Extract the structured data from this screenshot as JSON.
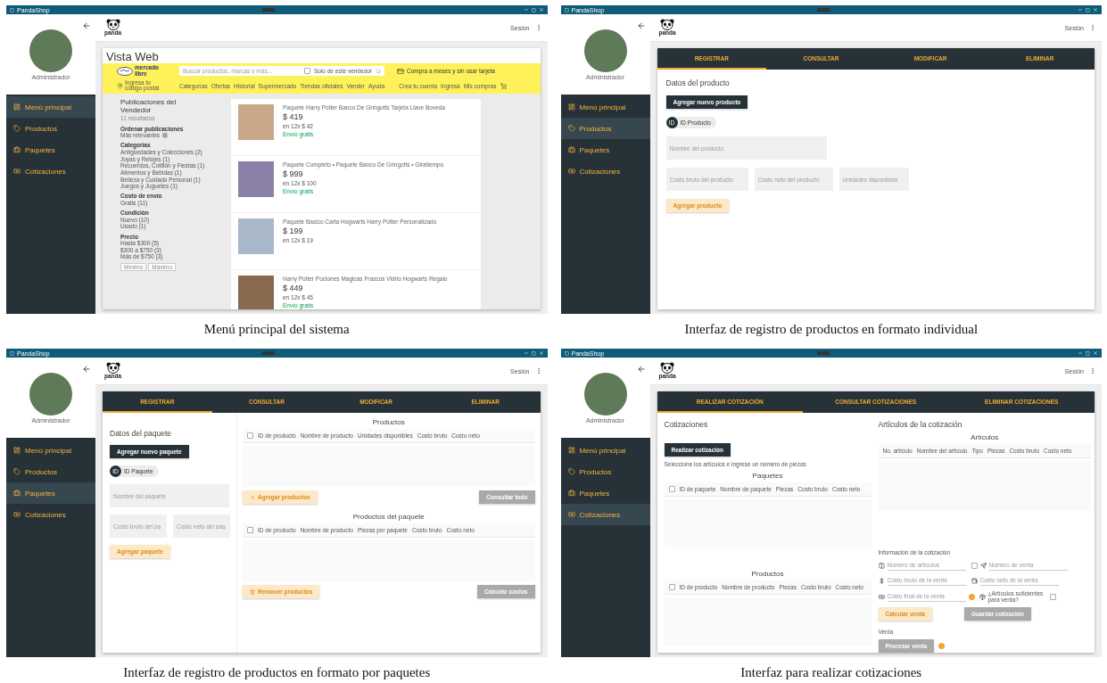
{
  "figures": [
    {
      "kind": "web",
      "caption": "Menú principal del sistema",
      "window_title": "PandaShop",
      "user": "Administrador",
      "session": "Sesión",
      "logo_text": "panda",
      "menu": [
        {
          "label": "Menú principal",
          "selected": true
        },
        {
          "label": "Productos",
          "selected": false
        },
        {
          "label": "Paquetes",
          "selected": false
        },
        {
          "label": "Cotizaciones",
          "selected": false
        }
      ],
      "content": {
        "title": "Vista Web",
        "store": {
          "logo_text": "mercado libre",
          "search_placeholder": "Buscar productos, marcas y más...",
          "seller_only": "Solo de este vendedor",
          "seller_only_checked": false,
          "promo": "Compra a meses y sin usar tarjeta",
          "location_top": "Ingresa tu",
          "location_bottom": "código postal",
          "nav": [
            "Categorías",
            "Ofertas",
            "Historial",
            "Supermercado",
            "Tiendas oficiales",
            "Vender",
            "Ayuda"
          ],
          "account": [
            "Crea tu cuenta",
            "Ingresa",
            "Mis compras"
          ]
        },
        "filters": {
          "title": "Publicaciones del Vendedor",
          "results": "11 resultados",
          "sort_title": "Ordenar publicaciones",
          "sort_value": "Más relevantes",
          "groups": [
            {
              "title": "Categorías",
              "items": [
                "Antigüedades y Colecciones (2)",
                "Joyas y Relojes (1)",
                "Recuerdos, Cotillón y Fiestas (1)",
                "Alimentos y Bebidas (1)",
                "Belleza y Cuidado Personal (1)",
                "Juegos y Juguetes (1)"
              ]
            },
            {
              "title": "Costo de envío",
              "items": [
                "Gratis (11)"
              ]
            },
            {
              "title": "Condición",
              "items": [
                "Nuevo (10)",
                "Usado (1)"
              ]
            },
            {
              "title": "Precio",
              "items": [
                "Hasta $300 (5)",
                "$300 a $750 (3)",
                "Más de $750 (3)"
              ]
            }
          ],
          "min": "Mínimo",
          "max": "Máximo"
        },
        "listings": [
          {
            "title": "Paquete Harry Potter Banco De Gringotts Tarjeta Llave Boveda",
            "price": "$ 419",
            "installments": "en 12x $ 42",
            "shipping": "Envío gratis"
          },
          {
            "title": "Paquete Completo • Paquete Banco De Gringotts • Giratiempo",
            "price": "$ 999",
            "installments": "en 12x $ 100",
            "shipping": "Envío gratis"
          },
          {
            "title": "Paquete Basico Carta Hogwarts Harry Potter Personalizado",
            "price": "$ 199",
            "installments": "en 12x $ 19"
          },
          {
            "title": "Harry Potter Pociones Magicas Frascos Vidrio Hogwarts Regalo",
            "price": "$ 449",
            "installments": "en 12x $ 45",
            "shipping": "Envío gratis"
          }
        ]
      }
    },
    {
      "kind": "product",
      "caption": "Interfaz de registro de productos en formato individual",
      "window_title": "PandaShop",
      "user": "Administrador",
      "session": "Sesión",
      "logo_text": "panda",
      "menu": [
        {
          "label": "Menú principal",
          "selected": false
        },
        {
          "label": "Productos",
          "selected": true
        },
        {
          "label": "Paquetes",
          "selected": false
        },
        {
          "label": "Cotizaciones",
          "selected": false
        }
      ],
      "tabs": [
        {
          "label": "REGISTRAR",
          "selected": true
        },
        {
          "label": "CONSULTAR",
          "selected": false
        },
        {
          "label": "MODIFICAR",
          "selected": false
        },
        {
          "label": "ELIMINAR",
          "selected": false
        }
      ],
      "content": {
        "title": "Datos del producto",
        "new_button": {
          "label": "Agregar nuevo producto",
          "kind": "primary"
        },
        "chip_avatar": "ID",
        "chip_label": "ID Producto",
        "name_placeholder": "Nombre del producto",
        "fields": [
          {
            "placeholder": "Costo bruto del producto"
          },
          {
            "placeholder": "Costo neto del producto"
          },
          {
            "placeholder": "Unidades disponibles"
          }
        ],
        "submit": {
          "label": "Agregar producto",
          "kind": "accent",
          "disabled": true
        }
      }
    },
    {
      "kind": "package",
      "caption": "Interfaz de registro de productos en formato por paquetes",
      "window_title": "PandaShop",
      "user": "Administrador",
      "session": "Sesión",
      "logo_text": "panda",
      "menu": [
        {
          "label": "Menú principal",
          "selected": false
        },
        {
          "label": "Productos",
          "selected": false
        },
        {
          "label": "Paquetes",
          "selected": true
        },
        {
          "label": "Cotizaciones",
          "selected": false
        }
      ],
      "tabs": [
        {
          "label": "REGISTRAR",
          "selected": true
        },
        {
          "label": "CONSULTAR",
          "selected": false
        },
        {
          "label": "MODIFICAR",
          "selected": false
        },
        {
          "label": "ELIMINAR",
          "selected": false
        }
      ],
      "content": {
        "title": "Datos del paquete",
        "new_button": {
          "label": "Agregar nuevo paquete",
          "kind": "primary"
        },
        "chip_avatar": "ID",
        "chip_label": "ID Paquete",
        "name_placeholder": "Nombre del paquete",
        "fields": [
          {
            "placeholder": "Costo bruto del pa"
          },
          {
            "placeholder": "Costo neto del paq"
          }
        ],
        "submit": {
          "label": "Agregar paquete",
          "kind": "accent",
          "disabled": true
        },
        "tables": [
          {
            "title": "Productos",
            "checked": false,
            "columns": [
              "ID de producto",
              "Nombre de producto",
              "Unidades disponibles",
              "Costo bruto",
              "Costo neto"
            ],
            "buttons": [
              {
                "label": "Agregar productos",
                "kind": "accent",
                "disabled": true
              },
              {
                "label": "Consultar todo",
                "kind": "neutral",
                "disabled": true
              }
            ]
          },
          {
            "title": "Productos del paquete",
            "checked": false,
            "columns": [
              "ID de producto",
              "Nombre de producto",
              "Piezas por paquete",
              "Costo bruto",
              "Costo neto"
            ],
            "buttons": [
              {
                "label": "Remover productos",
                "kind": "accent",
                "disabled": true
              },
              {
                "label": "Calcular costos",
                "kind": "neutral",
                "disabled": true
              }
            ]
          }
        ]
      }
    },
    {
      "kind": "quote",
      "caption": "Interfaz para realizar cotizaciones",
      "window_title": "PandaShop",
      "user": "Administrador",
      "session": "Sesión",
      "logo_text": "panda",
      "menu": [
        {
          "label": "Menú principal",
          "selected": false
        },
        {
          "label": "Productos",
          "selected": false
        },
        {
          "label": "Paquetes",
          "selected": false
        },
        {
          "label": "Cotizaciones",
          "selected": true
        }
      ],
      "tabs": [
        {
          "label": "REALIZAR COTIZACIÓN",
          "selected": true
        },
        {
          "label": "CONSULTAR COTIZACIONES",
          "selected": false
        },
        {
          "label": "ELIMINAR COTIZACIONES",
          "selected": false
        }
      ],
      "content": {
        "title": "Cotizaciones",
        "action": {
          "label": "Realizar cotización",
          "kind": "primary"
        },
        "instruction": "Seleccione los artículos e ingrese un número de piezas",
        "tables": [
          {
            "title": "Paquetes",
            "checked": false,
            "columns": [
              "ID de paquete",
              "Nombre de paquete",
              "Piezas",
              "Costo bruto",
              "Costo neto"
            ]
          },
          {
            "title": "Productos",
            "checked": false,
            "columns": [
              "ID de producto",
              "Nombre de producto",
              "Piezas",
              "Costo bruto",
              "Costo neto"
            ]
          }
        ],
        "right_title": "Artículos de la cotización",
        "articles": {
          "title": "Artículos",
          "columns": [
            "No. artículo",
            "Nombre del artículo",
            "Tipo",
            "Piezas",
            "Costo bruto",
            "Costo neto"
          ]
        },
        "info_title": "Información de la cotización",
        "fields": [
          {
            "placeholder": "Número de artículos"
          },
          {
            "placeholder": "Número de venta",
            "checked": false
          },
          {
            "placeholder": "Costo bruto de la venta"
          },
          {
            "placeholder": "Costo neto de la venta"
          },
          {
            "placeholder": "Costo final de la venta"
          }
        ],
        "sufficient": {
          "label": "¿Artículos suficientes para venta?",
          "checked": false
        },
        "buttons": [
          {
            "label": "Calcular venta",
            "kind": "accent",
            "disabled": true
          },
          {
            "label": "Guardar cotización",
            "kind": "neutral",
            "disabled": true
          }
        ],
        "sale_title": "Venta",
        "sale_button": {
          "label": "Procesar venta",
          "kind": "neutral",
          "disabled": true
        }
      }
    }
  ]
}
